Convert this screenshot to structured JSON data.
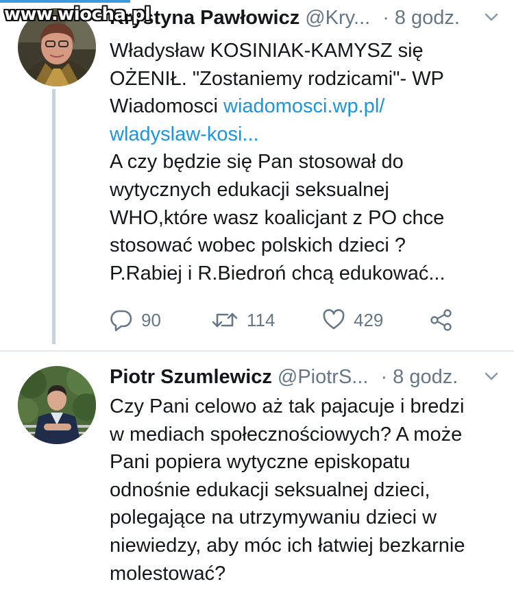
{
  "watermark": "www.wiocha.pl",
  "colors": {
    "accent": "#1b95e0",
    "muted": "#657786",
    "thread_line": "#c9d3dc"
  },
  "tweets": [
    {
      "name": "Krystyna Pawłowicz",
      "handle": "@Kry...",
      "dot": "·",
      "time": "8 godz.",
      "line1": "Władysław KOSINIAK-KAMYSZ się",
      "line2": "OŻENIŁ. \"Zostaniemy rodzicami\"- WP",
      "line3_text": "Wiadomosci ",
      "line3_link": "wiadomosci.wp.pl/",
      "line4_link": "wladyslaw-kosi...",
      "line5": "A czy będzie się Pan stosował do",
      "line6": "wytycznych edukacji seksualnej",
      "line7": "WHO,które wasz koalicjant z PO chce",
      "line8": "stosować wobec polskich dzieci ?",
      "line9": "P.Rabiej i R.Biedroń chcą edukować...",
      "replies": "90",
      "retweets": "114",
      "likes": "429",
      "icons": [
        "chevron-down-icon",
        "reply-icon",
        "retweet-icon",
        "like-icon",
        "share-icon"
      ]
    },
    {
      "name": "Piotr Szumlewicz",
      "handle": "@PiotrS...",
      "dot": "·",
      "time": "8 godz.",
      "line1": "Czy Pani celowo aż tak pajacuje i bredzi",
      "line2": "w mediach społecznościowych? A może",
      "line3": "Pani popiera wytyczne episkopatu",
      "line4": "odnośnie edukacji seksualnej dzieci,",
      "line5": "polegające na utrzymywaniu dzieci w",
      "line6": "niewiedzy, aby móc ich łatwiej bezkarnie",
      "line7": "molestować?",
      "icons": [
        "chevron-down-icon"
      ]
    }
  ]
}
